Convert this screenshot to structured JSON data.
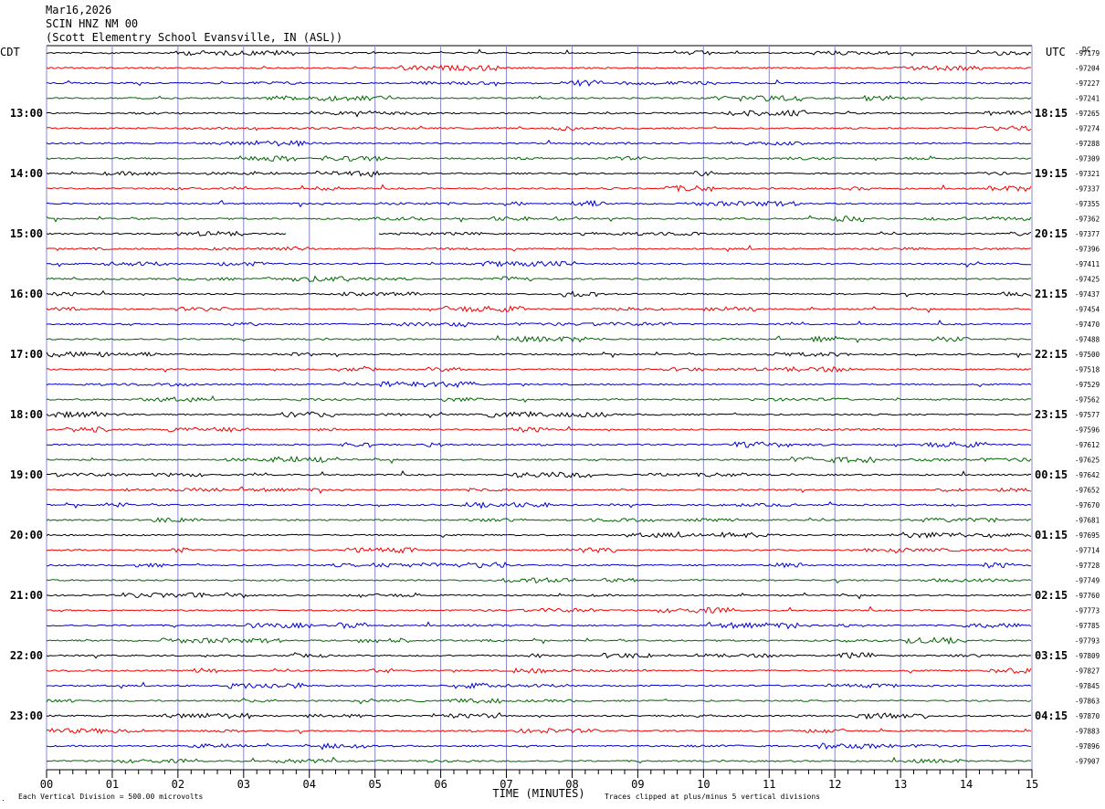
{
  "header": {
    "date": "Mar16,2026",
    "station": "SCIN HNZ NM 00",
    "location": "(Scott Elementry School Evansville, IN (ASL))"
  },
  "left_axis_title": "CDT",
  "right_axis_title": "UTC",
  "dc_label": "DC",
  "footer": {
    "scale_note": "Each Vertical Division =  500.00 microvolts",
    "clip_note": "Traces clipped at plus/minus 5 vertical divisions",
    "corner_mark": "․"
  },
  "colors": {
    "trace_cycle": [
      "#000000",
      "#ee0000",
      "#0000cc",
      "#006600"
    ],
    "grid": "#8888cc",
    "axis": "#000000"
  },
  "chart_data": {
    "type": "line",
    "title": "",
    "xlabel": "TIME (MINUTES)",
    "ylabel": "",
    "xlim": [
      0,
      15
    ],
    "x_ticks": [
      "00",
      "01",
      "02",
      "03",
      "04",
      "05",
      "06",
      "07",
      "08",
      "09",
      "10",
      "11",
      "12",
      "13",
      "14",
      "15"
    ],
    "minor_ticks_per_minute": 5,
    "grid": true,
    "rows_per_hour": 4,
    "left_hour_labels": [
      "13:00",
      "14:00",
      "15:00",
      "16:00",
      "17:00",
      "18:00",
      "19:00",
      "20:00",
      "21:00",
      "22:00",
      "23:00"
    ],
    "right_hour_labels": [
      "18:15",
      "19:15",
      "20:15",
      "21:15",
      "22:15",
      "23:15",
      "00:15",
      "01:15",
      "02:15",
      "03:15",
      "04:15"
    ],
    "trace_dc_offsets": [
      -97179,
      -97204,
      -97227,
      -97241,
      -97265,
      -97274,
      -97288,
      -97309,
      -97321,
      -97337,
      -97355,
      -97362,
      -97377,
      -97396,
      -97411,
      -97425,
      -97437,
      -97454,
      -97470,
      -97488,
      -97500,
      -97518,
      -97529,
      -97562,
      -97577,
      -97596,
      -97612,
      -97625,
      -97642,
      -97652,
      -97670,
      -97681,
      -97695,
      -97714,
      -97728,
      -97749,
      -97760,
      -97773,
      -97785,
      -97793,
      -97809,
      -97827,
      -97845,
      -97863,
      -97870,
      -97883,
      -97896,
      -97907
    ],
    "data_gap": {
      "trace_index": 12,
      "from_minute": 3.65,
      "to_minute": 5.05
    }
  }
}
